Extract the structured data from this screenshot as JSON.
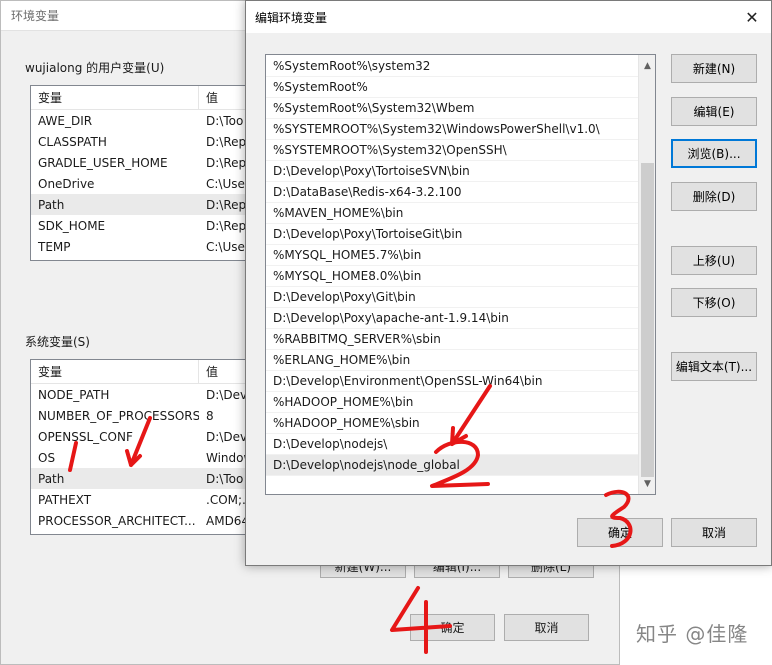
{
  "env_window": {
    "title": "环境变量",
    "user_group_label": "wujialong 的用户变量(U)",
    "user_table": {
      "headers": [
        "变量",
        "值"
      ],
      "rows": [
        {
          "name": "AWE_DIR",
          "value": "D:\\Too"
        },
        {
          "name": "CLASSPATH",
          "value": "D:\\Rep"
        },
        {
          "name": "GRADLE_USER_HOME",
          "value": "D:\\Rep"
        },
        {
          "name": "OneDrive",
          "value": "C:\\User"
        },
        {
          "name": "Path",
          "value": "D:\\Rep"
        },
        {
          "name": "SDK_HOME",
          "value": "D:\\Rep"
        },
        {
          "name": "TEMP",
          "value": "C:\\User"
        }
      ]
    },
    "system_group_label": "系统变量(S)",
    "system_table": {
      "headers": [
        "变量",
        "值"
      ],
      "rows": [
        {
          "name": "NODE_PATH",
          "value": "D:\\Deve"
        },
        {
          "name": "NUMBER_OF_PROCESSORS",
          "value": "8"
        },
        {
          "name": "OPENSSL_CONF",
          "value": "D:\\Deve"
        },
        {
          "name": "OS",
          "value": "Window"
        },
        {
          "name": "Path",
          "value": "D:\\Too"
        },
        {
          "name": "PATHEXT",
          "value": ".COM;."
        },
        {
          "name": "PROCESSOR_ARCHITECT...",
          "value": "AMD64"
        }
      ]
    },
    "system_buttons": {
      "new": "新建(W)...",
      "edit": "编辑(I)...",
      "delete": "删除(L)"
    },
    "ok_label": "确定",
    "cancel_label": "取消"
  },
  "edit_dialog": {
    "title": "编辑环境变量",
    "close_glyph": "✕",
    "paths": [
      "%SystemRoot%\\system32",
      "%SystemRoot%",
      "%SystemRoot%\\System32\\Wbem",
      "%SYSTEMROOT%\\System32\\WindowsPowerShell\\v1.0\\",
      "%SYSTEMROOT%\\System32\\OpenSSH\\",
      "D:\\Develop\\Poxy\\TortoiseSVN\\bin",
      "D:\\DataBase\\Redis-x64-3.2.100",
      "%MAVEN_HOME%\\bin",
      "D:\\Develop\\Poxy\\TortoiseGit\\bin",
      "%MYSQL_HOME5.7%\\bin",
      "%MYSQL_HOME8.0%\\bin",
      "D:\\Develop\\Poxy\\Git\\bin",
      "D:\\Develop\\Poxy\\apache-ant-1.9.14\\bin",
      "%RABBITMQ_SERVER%\\sbin",
      "%ERLANG_HOME%\\bin",
      "D:\\Develop\\Environment\\OpenSSL-Win64\\bin",
      "%HADOOP_HOME%\\bin",
      "%HADOOP_HOME%\\sbin",
      "D:\\Develop\\nodejs\\",
      "D:\\Develop\\nodejs\\node_global"
    ],
    "buttons": {
      "new": "新建(N)",
      "edit": "编辑(E)",
      "browse": "浏览(B)...",
      "delete": "删除(D)",
      "move_up": "上移(U)",
      "move_down": "下移(O)",
      "edit_text": "编辑文本(T)..."
    },
    "ok_label": "确定",
    "cancel_label": "取消"
  },
  "annotations": {
    "watermark": "知乎 @佳隆",
    "marker_color": "#e61717"
  }
}
